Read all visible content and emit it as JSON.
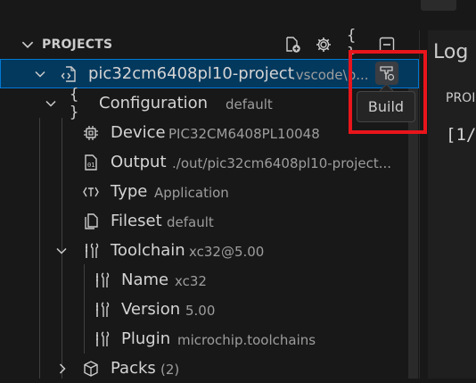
{
  "section": {
    "title": "PROJECTS",
    "actions": [
      {
        "name": "new-project-icon"
      },
      {
        "name": "gear-icon"
      },
      {
        "name": "braces-icon"
      },
      {
        "name": "collapse-all-icon"
      }
    ]
  },
  "tree": {
    "project": {
      "label": "pic32cm6408pl10-project",
      "desc": ".vscode\\p...",
      "action_icon": "build-icon"
    },
    "configuration": {
      "label": "Configuration",
      "desc": "default"
    },
    "device": {
      "label": "Device",
      "desc": "PIC32CM6408PL10048"
    },
    "output": {
      "label": "Output",
      "desc": "./out/pic32cm6408pl10-project..."
    },
    "type": {
      "label": "Type",
      "desc": "Application"
    },
    "fileset": {
      "label": "Fileset",
      "desc": "default"
    },
    "toolchain": {
      "label": "Toolchain",
      "desc": "xc32@5.00"
    },
    "name": {
      "label": "Name",
      "desc": "xc32"
    },
    "version": {
      "label": "Version",
      "desc": "5.00"
    },
    "plugin": {
      "label": "Plugin",
      "desc": "microchip.toolchains"
    },
    "packs": {
      "label": "Packs",
      "desc": "(2)"
    }
  },
  "tooltip": {
    "text": "Build"
  },
  "right_panel": {
    "tab": "Log",
    "line1": "PROI",
    "line2": "[1/"
  },
  "colors": {
    "accent": "#0078d4",
    "selection": "#04395e",
    "highlight": "#e8151b"
  }
}
